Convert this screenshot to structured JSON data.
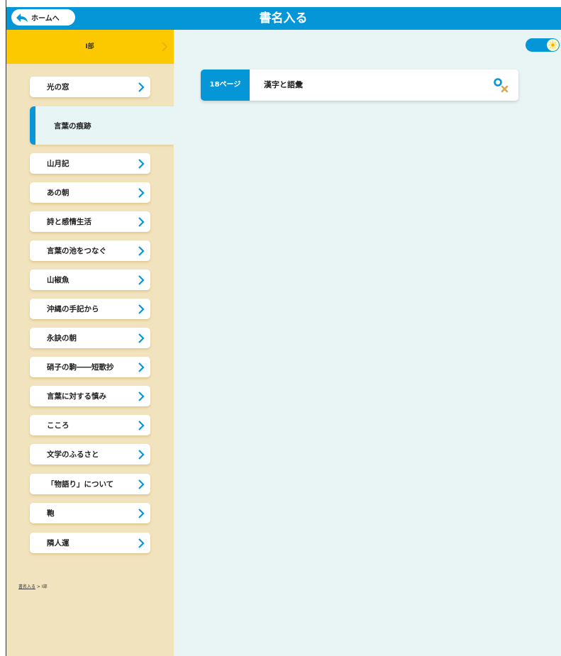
{
  "header": {
    "title": "書名入る",
    "home_label": "ホームへ",
    "color": "#0596d8"
  },
  "sidebar": {
    "section_label": "Ⅰ部",
    "section_color": "#fcc800",
    "background": "#f1e3bd",
    "items": [
      {
        "label": "光の窓",
        "active": false
      },
      {
        "label": "言葉の痕跡",
        "active": true
      },
      {
        "label": "山月記",
        "active": false
      },
      {
        "label": "あの朝",
        "active": false
      },
      {
        "label": "詩と感情生活",
        "active": false
      },
      {
        "label": "言葉の池をつなぐ",
        "active": false
      },
      {
        "label": "山椒魚",
        "active": false
      },
      {
        "label": "沖縄の手記から",
        "active": false
      },
      {
        "label": "永訣の朝",
        "active": false
      },
      {
        "label": "硝子の駒――短歌抄",
        "active": false
      },
      {
        "label": "言葉に対する慎み",
        "active": false
      },
      {
        "label": "こころ",
        "active": false
      },
      {
        "label": "文学のふるさと",
        "active": false
      },
      {
        "label": "「物語り」について",
        "active": false
      },
      {
        "label": "鞄",
        "active": false
      },
      {
        "label": "隣人運",
        "active": false
      }
    ],
    "breadcrumb": {
      "link": "書名入る",
      "separator": " > ",
      "current": "Ⅰ部"
    }
  },
  "main": {
    "background": "#e9f5f5",
    "card": {
      "page_label": "18ページ",
      "title": "漢字と語彙",
      "action_icon": "search-clear-icon"
    },
    "toggle": {
      "icon": "sun-icon",
      "on": true
    }
  }
}
